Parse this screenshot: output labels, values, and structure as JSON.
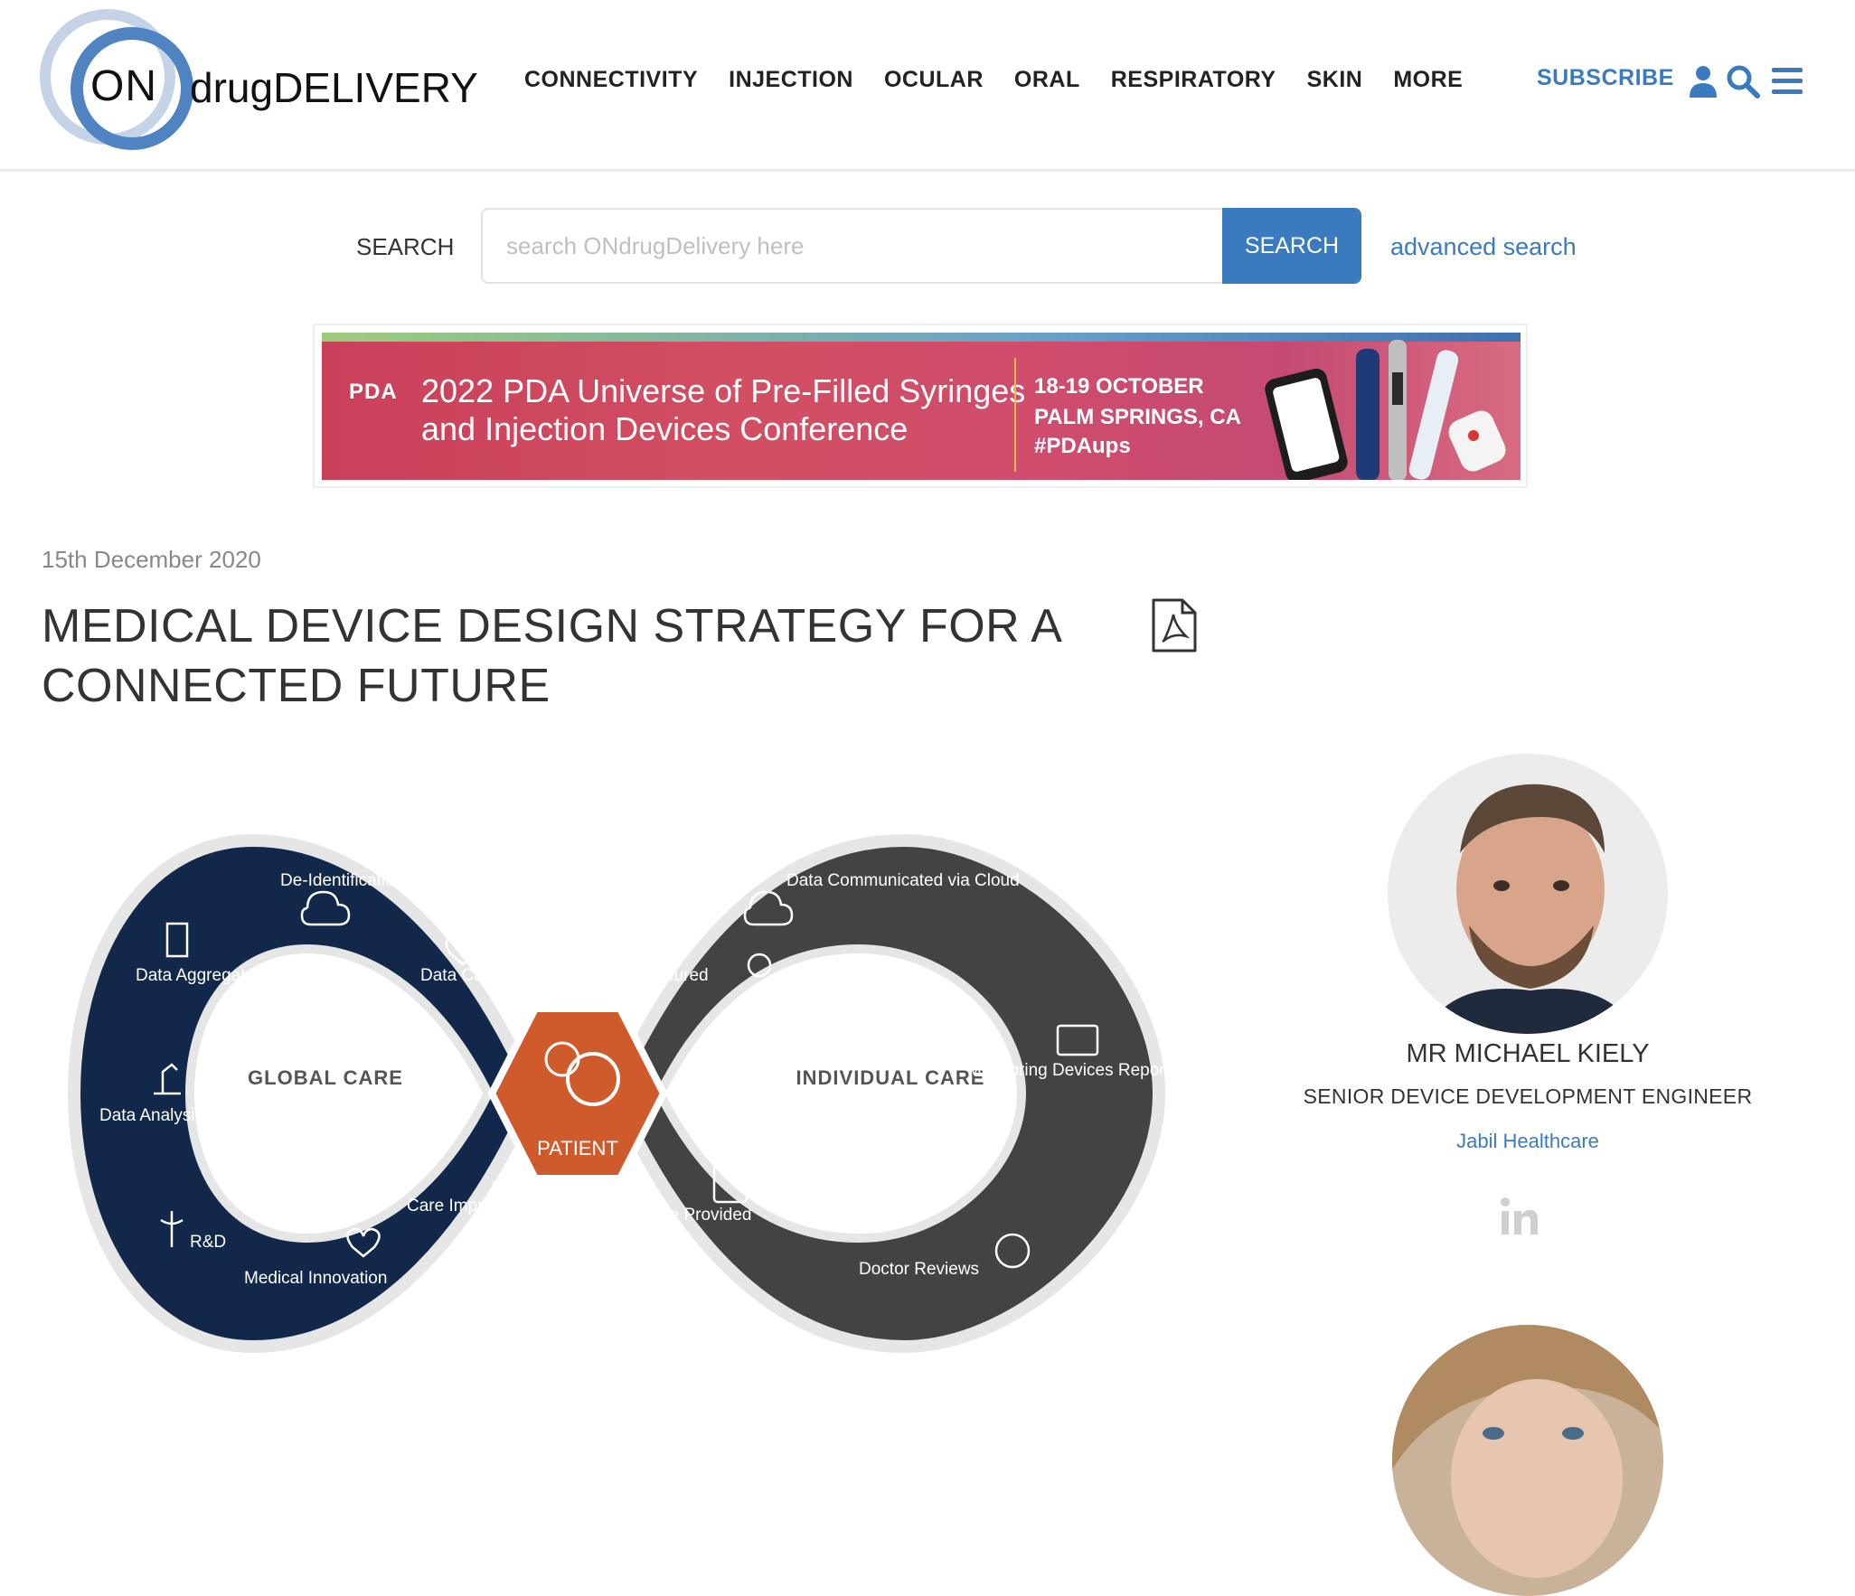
{
  "header": {
    "logo_on": "ON",
    "logo_brand": "drugDELIVERY",
    "nav": [
      "CONNECTIVITY",
      "INJECTION",
      "OCULAR",
      "ORAL",
      "RESPIRATORY",
      "SKIN",
      "MORE"
    ],
    "subscribe": "SUBSCRIBE",
    "icons": [
      "user-icon",
      "search-icon",
      "menu-icon"
    ]
  },
  "search": {
    "label": "SEARCH",
    "placeholder": "search ONdrugDelivery here",
    "value": "",
    "button": "SEARCH",
    "advanced": "advanced search"
  },
  "banner": {
    "logo": "PDA",
    "title_line1": "2022 PDA Universe of Pre-Filled Syringes",
    "title_line2": "and Injection Devices Conference",
    "dates": "18-19 OCTOBER",
    "place": "PALM SPRINGS, CA",
    "tag": "#PDAups"
  },
  "article": {
    "date": "15th December 2020",
    "title": "MEDICAL DEVICE DESIGN STRATEGY FOR A CONNECTED FUTURE"
  },
  "infographic": {
    "left_loop": "GLOBAL CARE",
    "right_loop": "INDIVIDUAL CARE",
    "center": "PATIENT",
    "left_labels": [
      "De-Identification of Data",
      "Data Aggregated",
      "Data Captured",
      "Data Analysis",
      "Care Improves",
      "R&D",
      "Medical Innovation"
    ],
    "right_labels": [
      "Data Communicated via Cloud",
      "Data Captured",
      "Monitoring Devices Report",
      "Care Provided",
      "Doctor Reviews"
    ],
    "colors": {
      "left": "#12284a",
      "right": "#434343",
      "center": "#cf5b2d",
      "rim": "#e6e6e6"
    }
  },
  "author": {
    "name": "MR MICHAEL KIELY",
    "role": "SENIOR DEVICE DEVELOPMENT ENGINEER",
    "company": "Jabil Healthcare",
    "social": "linkedin-icon"
  },
  "colors": {
    "accent": "#3a7bbf",
    "text": "#333333"
  }
}
